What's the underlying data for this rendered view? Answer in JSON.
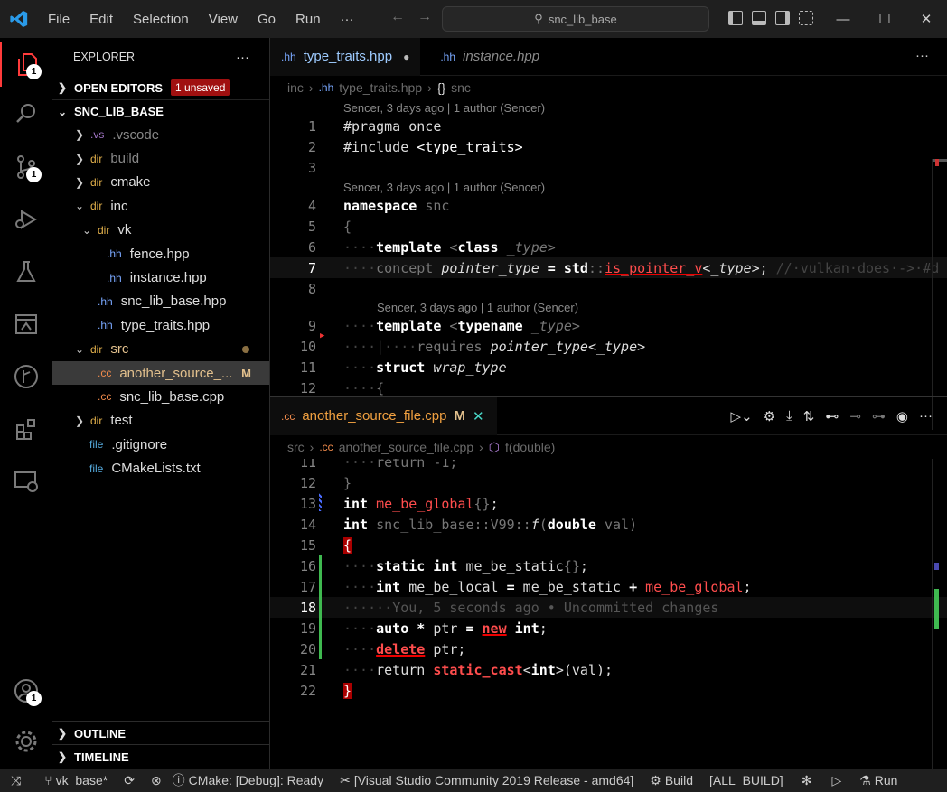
{
  "menu": [
    "File",
    "Edit",
    "Selection",
    "View",
    "Go",
    "Run",
    "···"
  ],
  "search": {
    "text": "snc_lib_base"
  },
  "activity_badges": {
    "explorer": "1",
    "scm": "1",
    "accounts": "1"
  },
  "explorer": {
    "title": "EXPLORER",
    "more": "···",
    "open_editors": "OPEN EDITORS",
    "unsaved": "1 unsaved",
    "root": "SNC_LIB_BASE",
    "items": [
      {
        "icon": ".vs",
        "label": ".vscode"
      },
      {
        "icon": "dir",
        "label": "build"
      },
      {
        "icon": "dir",
        "label": "cmake"
      },
      {
        "icon": "dir",
        "label": "inc"
      },
      {
        "icon": "dir",
        "label": "vk"
      },
      {
        "icon": ".hh",
        "label": "fence.hpp"
      },
      {
        "icon": ".hh",
        "label": "instance.hpp"
      },
      {
        "icon": ".hh",
        "label": "snc_lib_base.hpp"
      },
      {
        "icon": ".hh",
        "label": "type_traits.hpp"
      },
      {
        "icon": "dir",
        "label": "src"
      },
      {
        "icon": ".cc",
        "label": "another_source_...",
        "badge": "M"
      },
      {
        "icon": ".cc",
        "label": "snc_lib_base.cpp"
      },
      {
        "icon": "dir",
        "label": "test"
      },
      {
        "icon": "file",
        "label": ".gitignore"
      },
      {
        "icon": "file",
        "label": "CMakeLists.txt"
      }
    ],
    "outline": "OUTLINE",
    "timeline": "TIMELINE"
  },
  "top_editor": {
    "tabs": [
      {
        "ext": ".hh",
        "label": "type_traits.hpp"
      },
      {
        "ext": ".hh",
        "label": "instance.hpp"
      }
    ],
    "breadcrumb": {
      "a": "inc",
      "b_ext": ".hh",
      "b": "type_traits.hpp",
      "c_icon": "{}",
      "c": "snc"
    },
    "lens1": "Sencer, 3 days ago | 1 author (Sencer)",
    "lens2": "Sencer, 3 days ago | 1 author (Sencer)",
    "lens3": "Sencer, 3 days ago | 1 author (Sencer)",
    "line_numbers": [
      "1",
      "2",
      "3",
      "4",
      "5",
      "6",
      "7",
      "8",
      "9",
      "10",
      "11",
      "12"
    ]
  },
  "bottom_editor": {
    "tab": {
      "ext": ".cc",
      "label": "another_source_file.cpp",
      "badge": "M",
      "close": "✕"
    },
    "breadcrumb": {
      "a": "src",
      "b_ext": ".cc",
      "b": "another_source_file.cpp",
      "c": "f(double)"
    },
    "line_numbers": [
      "11",
      "12",
      "13",
      "14",
      "15",
      "16",
      "17",
      "18",
      "19",
      "20",
      "21",
      "22"
    ],
    "blame": "You, 5 seconds ago • Uncommitted changes"
  },
  "status": {
    "branch": "vk_base*",
    "cmake": "CMake: [Debug]: Ready",
    "kit": "[Visual Studio Community 2019 Release - amd64]",
    "build": "Build",
    "target": "[ALL_BUILD]",
    "run": "Run"
  },
  "colors": {
    "accent": "#ff3b3b",
    "unsaved_bg": "#a01010",
    "added": "#3fb950",
    "modified_dir": "#8a6f42"
  }
}
